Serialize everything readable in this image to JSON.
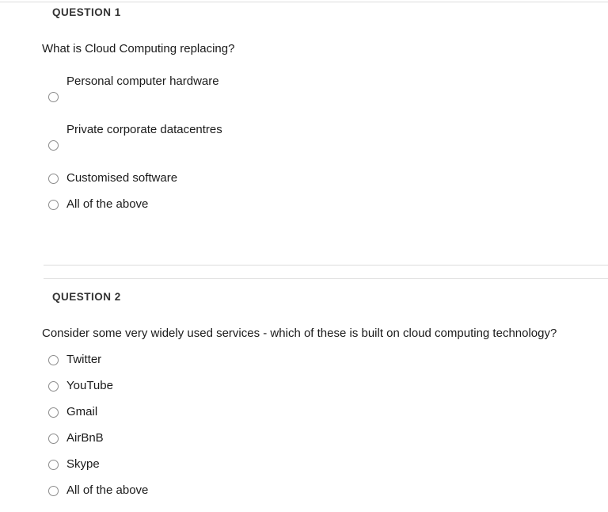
{
  "theme": {
    "background": "#ffffff",
    "heading_color": "#333333",
    "text_color": "#1a1a1a",
    "rule_color": "#dcdcdc",
    "radio_border_color": "#8c8c8c"
  },
  "questions": [
    {
      "heading": "QUESTION 1",
      "text": "What is Cloud Computing replacing?",
      "options": [
        {
          "label": "Personal computer hardware",
          "layout": "stacked",
          "selected": false
        },
        {
          "label": "Private corporate datacentres",
          "layout": "stacked",
          "selected": false
        },
        {
          "label": "Customised software",
          "layout": "inline",
          "selected": false
        },
        {
          "label": "All of the above",
          "layout": "inline",
          "selected": false
        }
      ]
    },
    {
      "heading": "QUESTION 2",
      "text": "Consider some very widely used services - which of these is built on cloud computing technology?",
      "options": [
        {
          "label": "Twitter",
          "layout": "inline",
          "selected": false
        },
        {
          "label": "YouTube",
          "layout": "inline",
          "selected": false
        },
        {
          "label": "Gmail",
          "layout": "inline",
          "selected": false
        },
        {
          "label": "AirBnB",
          "layout": "inline",
          "selected": false
        },
        {
          "label": "Skype",
          "layout": "inline",
          "selected": false
        },
        {
          "label": "All of the above",
          "layout": "inline",
          "selected": false
        }
      ]
    }
  ]
}
